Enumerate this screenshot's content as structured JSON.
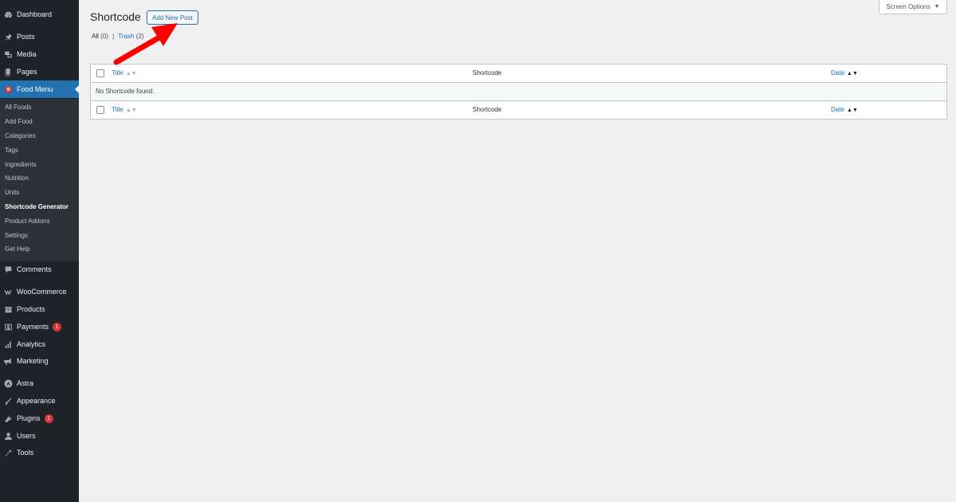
{
  "sidebar": {
    "dashboard": "Dashboard",
    "posts": "Posts",
    "media": "Media",
    "pages": "Pages",
    "food_menu": "Food Menu",
    "submenu": [
      "All Foods",
      "Add Food",
      "Categories",
      "Tags",
      "Ingredients",
      "Nutrition",
      "Units",
      "Shortcode Generator",
      "Product Addons",
      "Settings",
      "Get Help"
    ],
    "comments": "Comments",
    "woocommerce": "WooCommerce",
    "products": "Products",
    "payments": "Payments",
    "payments_badge": "1",
    "analytics": "Analytics",
    "marketing": "Marketing",
    "astra": "Astra",
    "appearance": "Appearance",
    "plugins": "Plugins",
    "plugins_badge": "1",
    "users": "Users",
    "tools": "Tools"
  },
  "header": {
    "title": "Shortcode",
    "add_new": "Add New Post",
    "screen_options": "Screen Options"
  },
  "filters": {
    "all_label": "All",
    "all_count": "(0)",
    "separator": "|",
    "trash_label": "Trash",
    "trash_count": "(2)"
  },
  "table": {
    "columns": [
      "Title",
      "Shortcode",
      "Date"
    ],
    "empty_message": "No Shortcode found."
  },
  "colors": {
    "sidebar_bg": "#1d2327",
    "accent": "#2271b1",
    "badge": "#d63638",
    "annotation": "#ff0000"
  }
}
